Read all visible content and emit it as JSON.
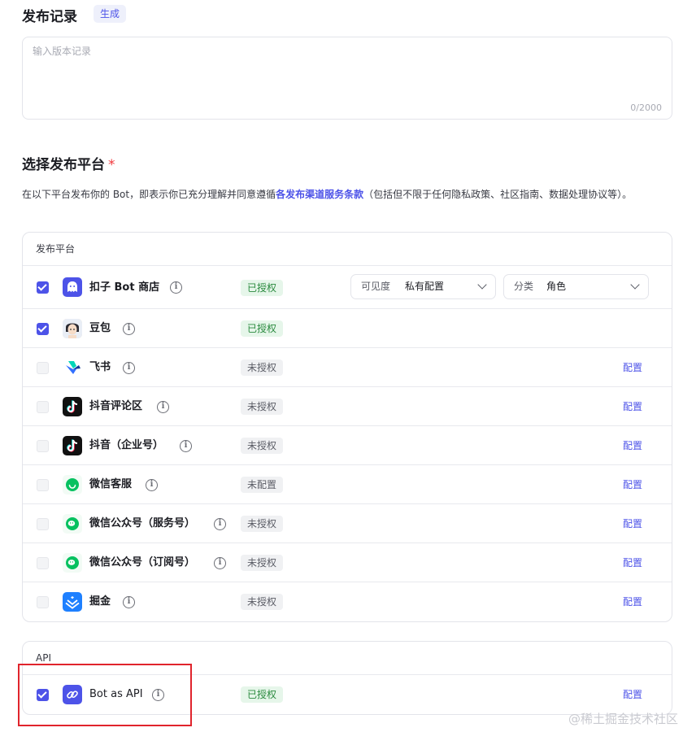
{
  "release_notes": {
    "title": "发布记录",
    "generate_label": "生成",
    "placeholder": "输入版本记录",
    "count": "0/2000"
  },
  "platform_section": {
    "title": "选择发布平台",
    "required_mark": "*",
    "description_before": "在以下平台发布你的 Bot，即表示你已充分理解并同意遵循",
    "description_link": "各发布渠道服务条款",
    "description_after": "（包括但不限于任何隐私政策、社区指南、数据处理协议等）。"
  },
  "platforms": {
    "header": "发布平台",
    "visibility_label": "可见度",
    "visibility_value": "私有配置",
    "category_label": "分类",
    "category_value": "角色",
    "config_label": "配置",
    "info_glyph": "i",
    "items": [
      {
        "name": "扣子 Bot 商店",
        "status": "已授权",
        "checked": true,
        "icon": "coze-store-icon",
        "color": "#4d53e8"
      },
      {
        "name": "豆包",
        "status": "已授权",
        "checked": true,
        "icon": "doubao-avatar-icon",
        "color": "#f3d9c8"
      },
      {
        "name": "飞书",
        "status": "未授权",
        "checked": false,
        "icon": "feishu-icon",
        "color": "#3370ff"
      },
      {
        "name": "抖音评论区",
        "status": "未授权",
        "checked": false,
        "icon": "douyin-icon",
        "color": "#111111"
      },
      {
        "name": "抖音（企业号）",
        "status": "未授权",
        "checked": false,
        "icon": "douyin-icon",
        "color": "#111111"
      },
      {
        "name": "微信客服",
        "status": "未配置",
        "checked": false,
        "icon": "wechat-service-icon",
        "color": "#07c160"
      },
      {
        "name": "微信公众号（服务号）",
        "status": "未授权",
        "checked": false,
        "icon": "wechat-icon",
        "color": "#07c160"
      },
      {
        "name": "微信公众号（订阅号）",
        "status": "未授权",
        "checked": false,
        "icon": "wechat-icon",
        "color": "#07c160"
      },
      {
        "name": "掘金",
        "status": "未授权",
        "checked": false,
        "icon": "juejin-icon",
        "color": "#1e80ff"
      }
    ]
  },
  "api": {
    "header": "API",
    "name": "Bot as API",
    "status": "已授权",
    "checked": true,
    "config_label": "配置",
    "icon": "link-icon",
    "color": "#4d53e8"
  },
  "watermark": "@稀土掘金技术社区"
}
